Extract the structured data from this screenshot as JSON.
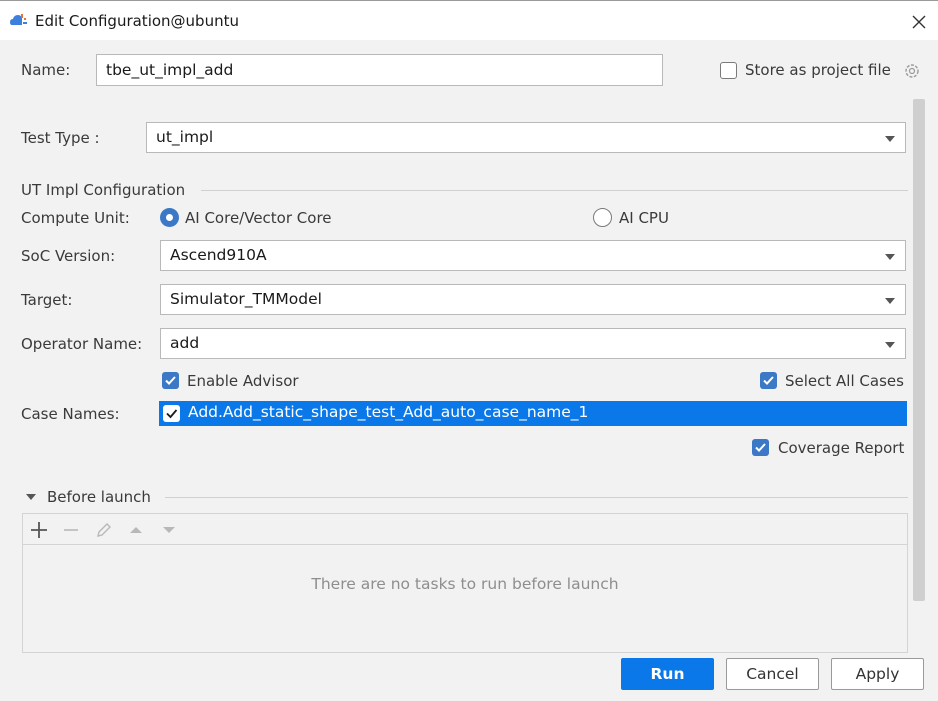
{
  "window": {
    "title": "Edit Configuration@ubuntu"
  },
  "name": {
    "label": "Name:",
    "value": "tbe_ut_impl_add"
  },
  "store_as_project_file": {
    "label": "Store as project file",
    "checked": false
  },
  "test_type": {
    "label": "Test Type :",
    "value": "ut_impl"
  },
  "ut_impl_section": {
    "title": "UT Impl Configuration"
  },
  "compute_unit": {
    "label": "Compute Unit:",
    "options": [
      {
        "label": "AI Core/Vector Core",
        "selected": true
      },
      {
        "label": "AI CPU",
        "selected": false
      }
    ]
  },
  "soc_version": {
    "label": "SoC Version:",
    "value": "Ascend910A"
  },
  "target": {
    "label": "Target:",
    "value": "Simulator_TMModel"
  },
  "operator_name": {
    "label": "Operator Name:",
    "value": "add"
  },
  "enable_advisor": {
    "label": "Enable Advisor",
    "checked": true
  },
  "select_all_cases": {
    "label": "Select All Cases",
    "checked": true
  },
  "case_names": {
    "label": "Case Names:",
    "items": [
      {
        "label": "Add.Add_static_shape_test_Add_auto_case_name_1",
        "checked": true,
        "selected": true
      }
    ]
  },
  "coverage_report": {
    "label": "Coverage Report",
    "checked": true
  },
  "before_launch": {
    "title": "Before launch",
    "empty_text": "There are no tasks to run before launch",
    "toolbar": [
      "add-icon",
      "remove-icon",
      "edit-icon",
      "move-up-icon",
      "move-down-icon"
    ]
  },
  "buttons": {
    "run": "Run",
    "cancel": "Cancel",
    "apply": "Apply"
  },
  "colors": {
    "accent": "#0a78e8",
    "checkbox": "#3b78c6",
    "background": "#f2f2f2"
  }
}
